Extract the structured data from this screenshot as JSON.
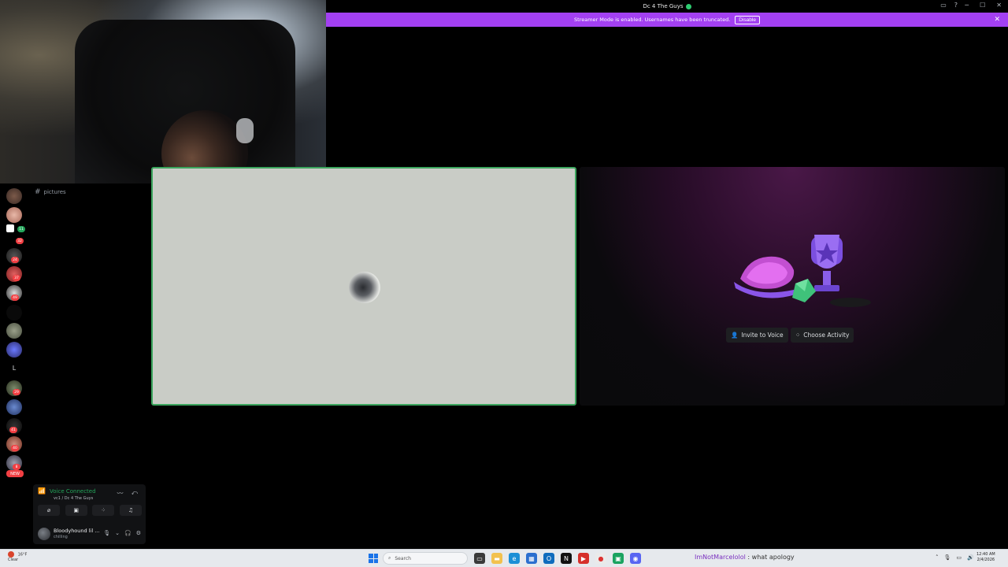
{
  "window": {
    "title": "Dc 4 The Guys",
    "controls": {
      "minimize": "─",
      "maximize": "☐",
      "close": "✕"
    }
  },
  "streamer_banner": {
    "text": "Streamer Mode is enabled. Usernames have been truncated.",
    "disable_label": "Disable",
    "close": "✕"
  },
  "server_rail": {
    "badges": [
      "11",
      "32",
      "24",
      "37",
      "49",
      "29",
      "41",
      "40",
      "8"
    ],
    "letter_server": "L",
    "new_badge": "NEW"
  },
  "channel_list": {
    "active_channel": "pictures"
  },
  "voice_panel": {
    "status": "Voice Connected",
    "location": "vc1 / Dc 4 The Guys"
  },
  "user_panel": {
    "username": "Bloodyhound lil ...",
    "status": "chilling"
  },
  "stage": {
    "invite_label": "Invite to Voice",
    "activity_label": "Choose Activity"
  },
  "taskbar": {
    "weather_temp": "16°F",
    "weather_desc": "Clear",
    "search_placeholder": "Search",
    "ticker_user": "ImNotMarcelolol",
    "ticker_text": ": what apology",
    "time": "12:40 AM",
    "date": "2/4/2026"
  },
  "colors": {
    "banner": "#a340f2",
    "voice_green": "#23a55a",
    "badge_red": "#f23f43",
    "speaking_border": "#3ba55d"
  }
}
